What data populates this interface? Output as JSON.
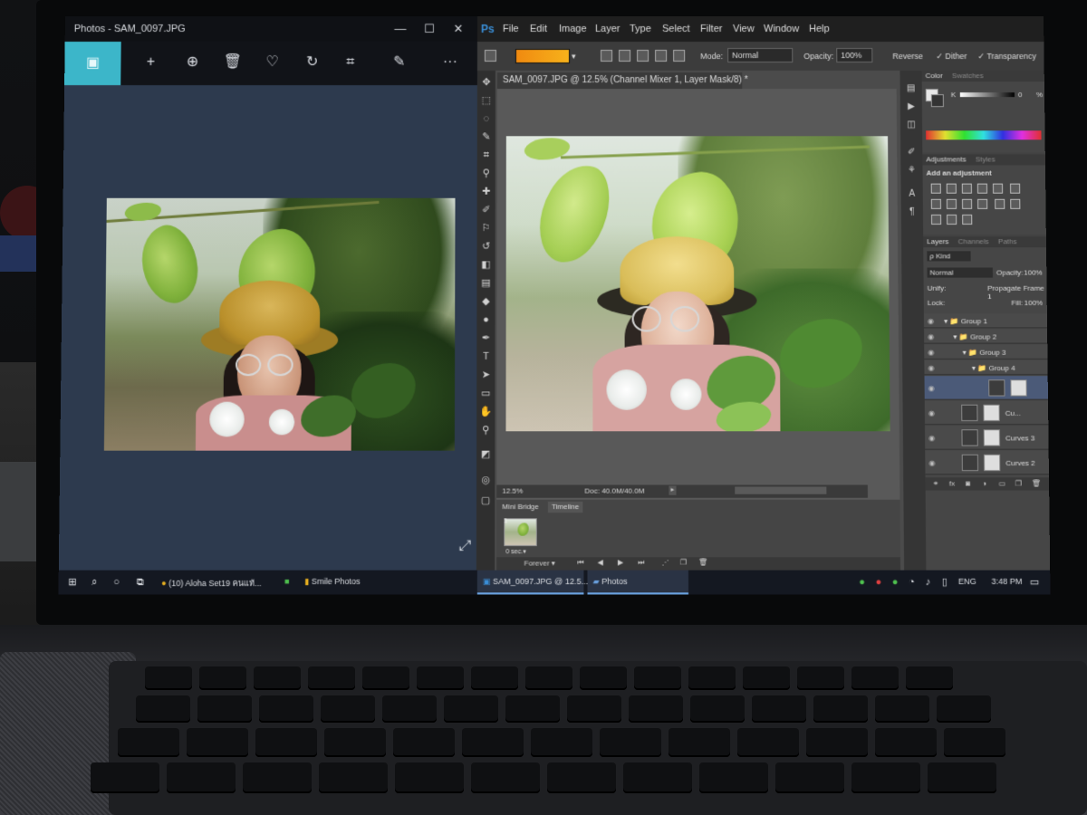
{
  "photos": {
    "title": "Photos - SAM_0097.JPG",
    "toolbar": {
      "slideshow": "▣",
      "add": "+",
      "zoom": "⊕",
      "delete": "🗑",
      "favorite": "♡",
      "rotate": "↻",
      "crop": "⌗",
      "edit": "✎",
      "more": "···"
    }
  },
  "photoshop": {
    "logo": "Ps",
    "menu": [
      "File",
      "Edit",
      "Image",
      "Layer",
      "Type",
      "Select",
      "Filter",
      "View",
      "Window",
      "Help"
    ],
    "options": {
      "mode_label": "Mode:",
      "mode_value": "Normal",
      "opacity_label": "Opacity:",
      "opacity_value": "100%",
      "reverse": "Reverse",
      "dither": "✓ Dither",
      "transparency": "✓ Transparency"
    },
    "document_tab": "SAM_0097.JPG @ 12.5% (Channel Mixer 1, Layer Mask/8) *",
    "document_close": "×",
    "status": {
      "zoom": "12.5%",
      "doc": "Doc: 40.0M/40.0M"
    },
    "minibridge": {
      "tab1": "Mini Bridge",
      "tab2": "Timeline",
      "frame_number": "1",
      "frame_delay": "0 sec.▾",
      "loop": "Forever ▾"
    },
    "color_panel": {
      "tab1": "Color",
      "tab2": "Swatches",
      "k_label": "K",
      "k_value": "0",
      "k_unit": "%"
    },
    "adjustments_panel": {
      "tab1": "Adjustments",
      "tab2": "Styles",
      "heading": "Add an adjustment"
    },
    "layers_panel": {
      "tab1": "Layers",
      "tab2": "Channels",
      "tab3": "Paths",
      "kind": "ρ Kind",
      "blend_mode": "Normal",
      "opacity_label": "Opacity:",
      "opacity_value": "100%",
      "unify_label": "Unify:",
      "propagate": "Propagate Frame 1",
      "lock_label": "Lock:",
      "fill_label": "Fill:",
      "fill_value": "100%",
      "layers": [
        {
          "name": "Group 1"
        },
        {
          "name": "Group 2"
        },
        {
          "name": "Group 3"
        },
        {
          "name": "Group 4"
        },
        {
          "name": "Cu..."
        },
        {
          "name": "Curves 3"
        },
        {
          "name": "Curves 2"
        }
      ]
    }
  },
  "taskbar": {
    "start": "⊞",
    "search": "⌕",
    "cortana": "○",
    "taskview": "⧉",
    "items": [
      {
        "label": "(10) Aloha Set19 คนแท้..."
      },
      {
        "label": "Smile Photos"
      },
      {
        "label": "SAM_0097.JPG @ 12.5..."
      },
      {
        "label": "Photos"
      }
    ],
    "language": "ENG",
    "time": "3:48 PM",
    "notifications": "▭"
  },
  "colors": {
    "photos_accent": "#3cb6c9",
    "ps_logo": "#3a8fd8",
    "gradient_start": "#f08a10",
    "gradient_end": "#f7b21b",
    "selected_layer": "#4b5a78"
  }
}
